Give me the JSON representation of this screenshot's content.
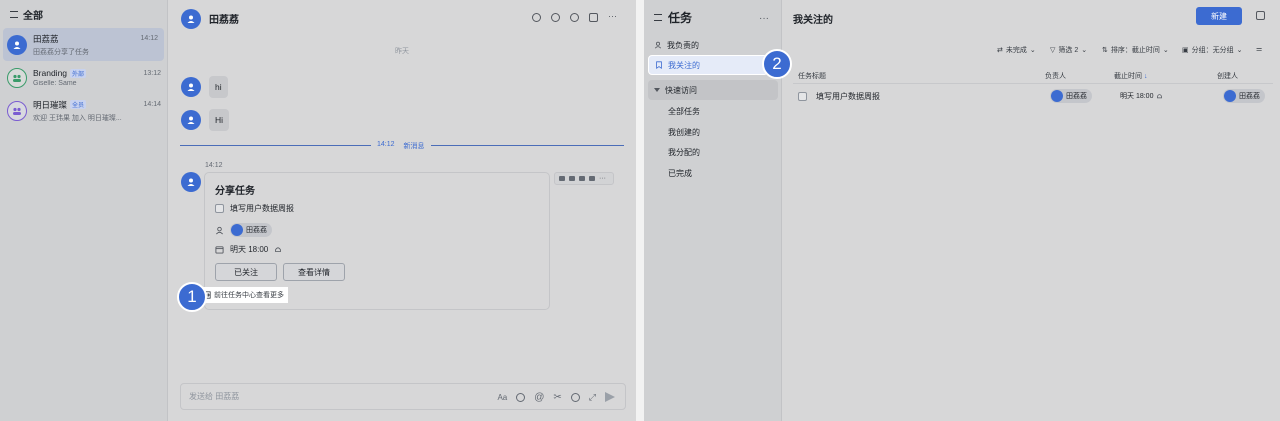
{
  "chat_list": {
    "header": "全部",
    "items": [
      {
        "name": "田荔荔",
        "time": "14:12",
        "preview": "田荔荔分享了任务",
        "tag": ""
      },
      {
        "name": "Branding",
        "time": "13:12",
        "preview": "Giselle: Same",
        "tag": "外部"
      },
      {
        "name": "明日璀璨",
        "time": "14:14",
        "preview": "欢迎 王玮果 加入 明日璀璨...",
        "tag": "全员"
      }
    ]
  },
  "chat": {
    "title": "田荔荔",
    "date_sep": "昨天",
    "messages": [
      "hi",
      "Hi"
    ],
    "new_msg_time": "14:12",
    "new_msg_label": "新消息",
    "card_time": "14:12",
    "card": {
      "title": "分享任务",
      "task": "填写用户数据周报",
      "assignee": "田荔荔",
      "due": "明天 18:00",
      "follow_btn": "已关注",
      "detail_btn": "查看详情",
      "footer": "前往任务中心查看更多"
    },
    "input_placeholder": "发送给 田荔荔"
  },
  "steps": {
    "one": "1",
    "two": "2"
  },
  "task_center": {
    "title": "任务",
    "nav": {
      "mine": "我负责的",
      "following": "我关注的",
      "quick": "快速访问",
      "all": "全部任务",
      "created": "我创建的",
      "assigned": "我分配的",
      "done": "已完成"
    },
    "page_title": "我关注的",
    "new_button": "新建",
    "toolbar": {
      "status": "未完成",
      "filter": "筛选 2",
      "sort": "排序：截止时间",
      "group": "分组：无分组"
    },
    "columns": {
      "title": "任务标题",
      "assignee": "负责人",
      "due": "截止时间",
      "creator": "创建人"
    },
    "rows": [
      {
        "title": "填写用户数据周报",
        "assignee": "田荔荔",
        "due": "明天 18:00",
        "creator": "田荔荔"
      }
    ]
  }
}
